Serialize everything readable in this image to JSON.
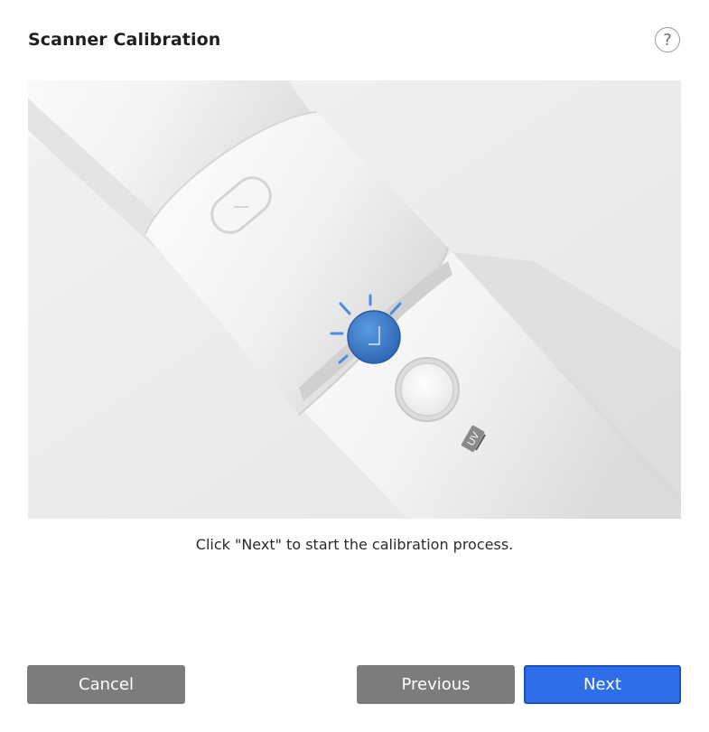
{
  "dialog": {
    "title": "Scanner Calibration",
    "help_label": "?",
    "instruction": "Click \"Next\" to start the calibration process.",
    "illustration": {
      "uv_label": "UV",
      "icons": [
        "scanner-device-illustration",
        "highlighted-button-icon",
        "round-button-icon"
      ]
    }
  },
  "buttons": {
    "cancel": "Cancel",
    "previous": "Previous",
    "next": "Next"
  },
  "colors": {
    "accent": "#2e6ee8",
    "secondary_button": "#7c7c7c",
    "highlight_button": "#3f7fd0"
  }
}
